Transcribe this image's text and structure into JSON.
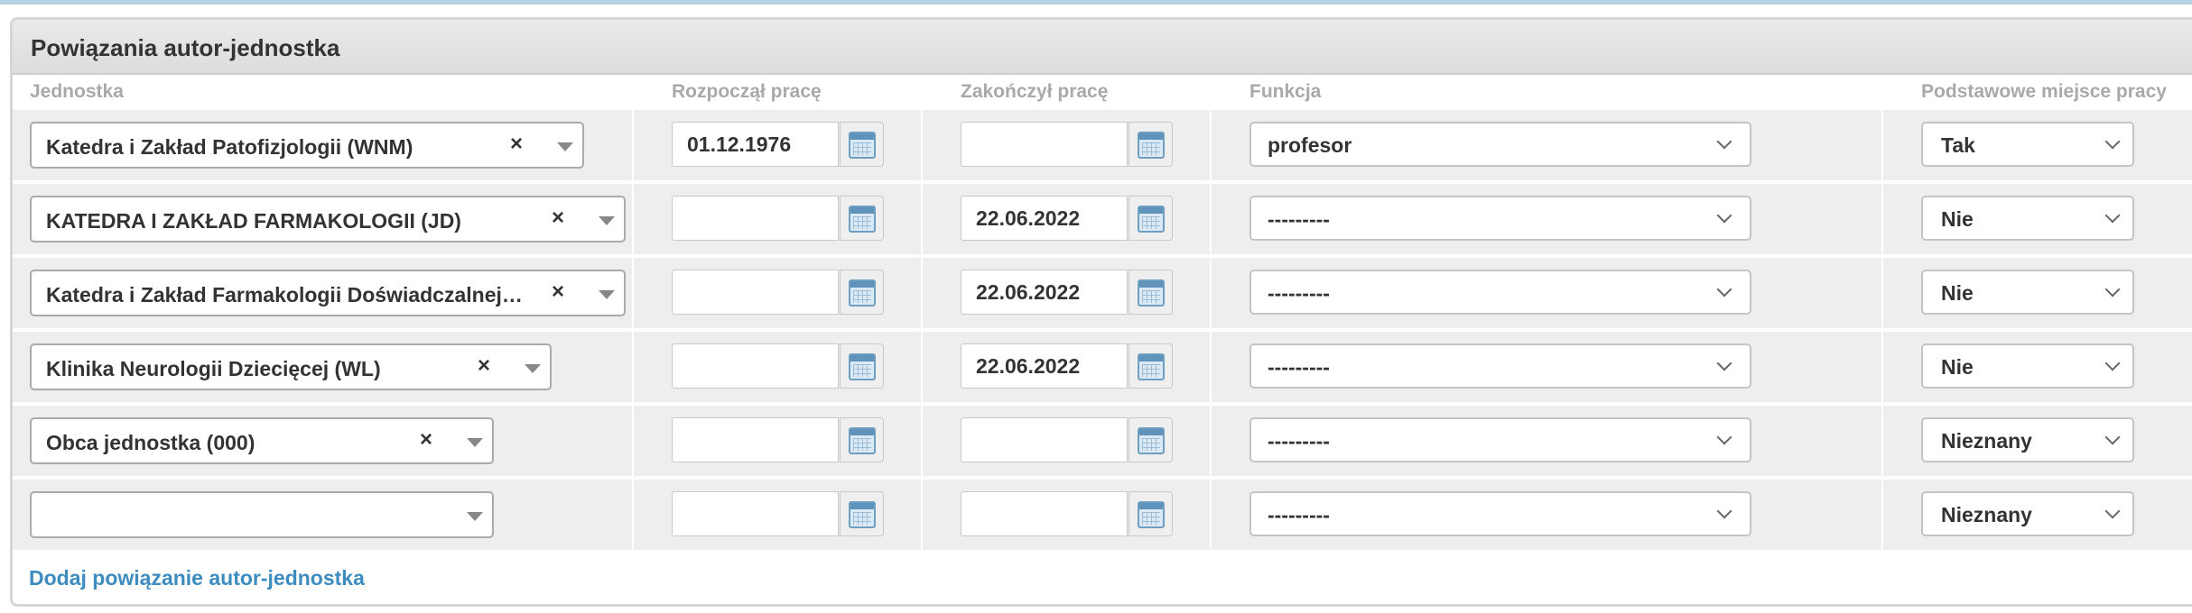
{
  "module": {
    "title": "Powiązania autor-jednostka",
    "add_link": "Dodaj powiązanie autor-jednostka"
  },
  "columns": {
    "unit": "Jednostka",
    "start": "Rozpoczął pracę",
    "end": "Zakończył pracę",
    "function": "Funkcja",
    "primary": "Podstawowe miejsce pracy"
  },
  "rows": [
    {
      "unit": "Katedra i Zakład Patofizjologii (WNM)",
      "start": "01.12.1976",
      "end": "",
      "function": "profesor",
      "primary": "Tak"
    },
    {
      "unit": "KATEDRA I ZAKŁAD FARMAKOLOGII (JD)",
      "start": "",
      "end": "22.06.2022",
      "function": "---------",
      "primary": "Nie"
    },
    {
      "unit": "Katedra i Zakład Farmakologii Doświadczalnej…",
      "start": "",
      "end": "22.06.2022",
      "function": "---------",
      "primary": "Nie"
    },
    {
      "unit": "Klinika Neurologii Dziecięcej (WL)",
      "start": "",
      "end": "22.06.2022",
      "function": "---------",
      "primary": "Nie"
    },
    {
      "unit": "Obca jednostka (000)",
      "start": "",
      "end": "",
      "function": "---------",
      "primary": "Nieznany"
    },
    {
      "unit": "",
      "start": "",
      "end": "",
      "function": "---------",
      "primary": "Nieznany"
    }
  ],
  "icons": {
    "clear": "×",
    "calendar": "calendar-icon",
    "chevron": "chevron-down-icon",
    "triangle": "triangle-down-icon"
  }
}
